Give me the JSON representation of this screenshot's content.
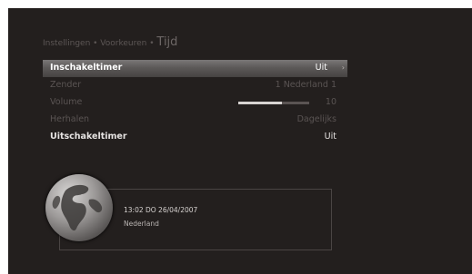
{
  "breadcrumb": {
    "path": "Instellingen • Voorkeuren •",
    "current": "Tijd"
  },
  "menu": {
    "items": [
      {
        "label": "Inschakeltimer",
        "value": "Uit",
        "arrow": "›"
      },
      {
        "label": "Zender",
        "value": "1 Nederland 1"
      },
      {
        "label": "Volume",
        "value": "10",
        "volume_level_percent": 62
      },
      {
        "label": "Herhalen",
        "value": "Dagelijks"
      },
      {
        "label": "Uitschakeltimer",
        "value": "Uit"
      }
    ]
  },
  "info": {
    "time": "13:02 DO 26/04/2007",
    "region": "Nederland"
  },
  "icons": {
    "globe": "globe-icon"
  },
  "colors": {
    "screen_bg": "#231f1e",
    "highlight": "#6a6766",
    "disabled_text": "#5a5453",
    "active_text": "#e6e3e2"
  }
}
